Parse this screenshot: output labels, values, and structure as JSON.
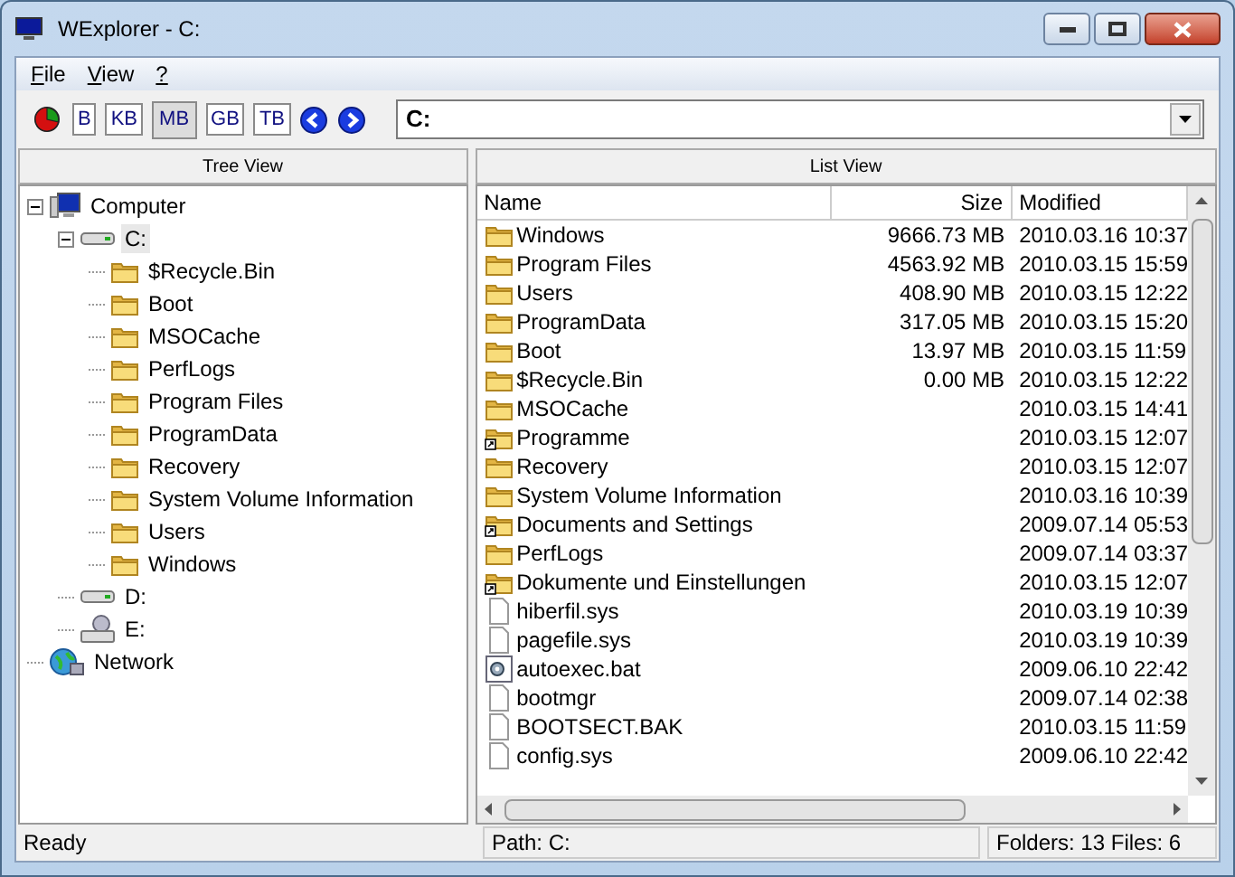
{
  "window": {
    "title": "WExplorer - C:"
  },
  "menu": [
    {
      "label": "File",
      "mnemonic": true
    },
    {
      "label": "View",
      "mnemonic": true
    },
    {
      "label": "?",
      "mnemonic": true
    }
  ],
  "toolbar": {
    "buttons": [
      {
        "kind": "chart"
      },
      {
        "kind": "unit",
        "label": "B",
        "selected": false
      },
      {
        "kind": "unit",
        "label": "KB",
        "selected": false
      },
      {
        "kind": "unit",
        "label": "MB",
        "selected": true
      },
      {
        "kind": "unit",
        "label": "GB",
        "selected": false
      },
      {
        "kind": "unit",
        "label": "TB",
        "selected": false
      },
      {
        "kind": "back"
      },
      {
        "kind": "forward"
      }
    ],
    "path_combo": {
      "value": "C:"
    }
  },
  "tree_view": {
    "header": "Tree View",
    "items": [
      {
        "label": "Computer",
        "kind": "computer",
        "expanded": true,
        "selected": false,
        "children": [
          {
            "label": "C:",
            "kind": "drive",
            "expanded": true,
            "selected": true,
            "children": [
              {
                "label": "$Recycle.Bin",
                "kind": "folder",
                "selected": false
              },
              {
                "label": "Boot",
                "kind": "folder",
                "selected": false
              },
              {
                "label": "MSOCache",
                "kind": "folder",
                "selected": false
              },
              {
                "label": "PerfLogs",
                "kind": "folder",
                "selected": false
              },
              {
                "label": "Program Files",
                "kind": "folder",
                "selected": false
              },
              {
                "label": "ProgramData",
                "kind": "folder",
                "selected": false
              },
              {
                "label": "Recovery",
                "kind": "folder",
                "selected": false
              },
              {
                "label": "System Volume Information",
                "kind": "folder",
                "selected": false
              },
              {
                "label": "Users",
                "kind": "folder",
                "selected": false
              },
              {
                "label": "Windows",
                "kind": "folder",
                "selected": false
              }
            ]
          },
          {
            "label": "D:",
            "kind": "drive",
            "selected": false
          },
          {
            "label": "E:",
            "kind": "cdrom",
            "selected": false
          }
        ]
      },
      {
        "label": "Network",
        "kind": "network",
        "selected": false
      }
    ]
  },
  "list_view": {
    "header": "List View",
    "columns": [
      "Name",
      "Size",
      "Modified"
    ],
    "rows": [
      {
        "name": "Windows",
        "kind": "folder",
        "size": "9666.73 MB",
        "modified": "2010.03.16 10:37"
      },
      {
        "name": "Program Files",
        "kind": "folder",
        "size": "4563.92 MB",
        "modified": "2010.03.15 15:59"
      },
      {
        "name": "Users",
        "kind": "folder",
        "size": "408.90 MB",
        "modified": "2010.03.15 12:22"
      },
      {
        "name": "ProgramData",
        "kind": "folder",
        "size": "317.05 MB",
        "modified": "2010.03.15 15:20"
      },
      {
        "name": "Boot",
        "kind": "folder",
        "size": "13.97 MB",
        "modified": "2010.03.15 11:59"
      },
      {
        "name": "$Recycle.Bin",
        "kind": "folder",
        "size": "0.00 MB",
        "modified": "2010.03.15 12:22"
      },
      {
        "name": "MSOCache",
        "kind": "folder",
        "modified": "2010.03.15 14:41"
      },
      {
        "name": "Programme",
        "kind": "shortcut",
        "modified": "2010.03.15 12:07"
      },
      {
        "name": "Recovery",
        "kind": "folder",
        "modified": "2010.03.15 12:07"
      },
      {
        "name": "System Volume Information",
        "kind": "folder",
        "modified": "2010.03.16 10:39"
      },
      {
        "name": "Documents and Settings",
        "kind": "shortcut",
        "modified": "2009.07.14 05:53"
      },
      {
        "name": "PerfLogs",
        "kind": "folder",
        "modified": "2009.07.14 03:37"
      },
      {
        "name": "Dokumente und Einstellungen",
        "kind": "shortcut",
        "modified": "2010.03.15 12:07"
      },
      {
        "name": "hiberfil.sys",
        "kind": "file",
        "modified": "2010.03.19 10:39"
      },
      {
        "name": "pagefile.sys",
        "kind": "file",
        "modified": "2010.03.19 10:39"
      },
      {
        "name": "autoexec.bat",
        "kind": "batch",
        "modified": "2009.06.10 22:42"
      },
      {
        "name": "bootmgr",
        "kind": "file",
        "modified": "2009.07.14 02:38"
      },
      {
        "name": "BOOTSECT.BAK",
        "kind": "file",
        "modified": "2010.03.15 11:59"
      },
      {
        "name": "config.sys",
        "kind": "file",
        "modified": "2009.06.10 22:42"
      }
    ]
  },
  "status_bar": {
    "left": "Ready",
    "path": "Path: C:",
    "counts": "Folders: 13 Files: 6"
  }
}
